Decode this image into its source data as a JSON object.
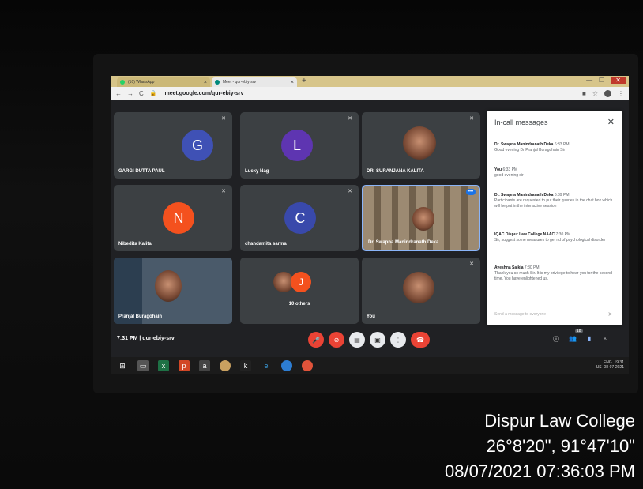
{
  "browser": {
    "tabs": [
      {
        "label": "(10) WhatsApp"
      },
      {
        "label": "Meet - qur-ebiy-srv"
      }
    ],
    "url": "meet.google.com/qur-ebiy-srv"
  },
  "participants": [
    {
      "name": "GARGI DUTTA PAUL",
      "initial": "G",
      "color": "#3f51b5"
    },
    {
      "name": "Lucky Nag",
      "initial": "L",
      "color": "#5e35b1"
    },
    {
      "name": "DR. SURANJANA KALITA"
    },
    {
      "name": "Nibedita Kalita",
      "initial": "N",
      "color": "#f4511e"
    },
    {
      "name": "chandamita sarma",
      "initial": "C",
      "color": "#3949ab"
    },
    {
      "name": "Dr. Swapna Manindranath Deka"
    },
    {
      "name": "Pranjal Buragohain"
    },
    {
      "name": "10 others",
      "initial": "J",
      "color": "#f4511e"
    },
    {
      "name": "You"
    }
  ],
  "chat": {
    "title": "In-call messages",
    "messages": [
      {
        "sender": "Dr. Swapna Manindranath Deka",
        "time": "6:33 PM",
        "text": "Good evening Dr Pranjal Buragohain Sir"
      },
      {
        "sender": "You",
        "time": "6:33 PM",
        "text": "good evening sir"
      },
      {
        "sender": "Dr. Swapna Manindranath Deka",
        "time": "6:39 PM",
        "text": "Participants are requested to put their queries in the chat box which will be put in the interactive session"
      },
      {
        "sender": "IQAC Dispur Law College NAAC",
        "time": "7:30 PM",
        "text": "Sir, suggest some measures to get rid of psychological disorder"
      },
      {
        "sender": "Ayeshna Saikia",
        "time": "7:30 PM",
        "text": "Thank you so much Sir. It is my privilege to hear you for the second time. You have enlightened us."
      }
    ],
    "input_placeholder": "Send a message to everyone"
  },
  "meeting": {
    "info": "7:31 PM  |  qur-ebiy-srv",
    "people_count": "18"
  },
  "taskbar": {
    "lang": "ENG",
    "region": "US",
    "time": "19:31",
    "date": "08-07-2021"
  },
  "watermark": {
    "place": "Dispur Law College",
    "coords": "26°8'20\", 91°47'10\"",
    "datetime": "08/07/2021 07:36:03 PM"
  },
  "colors": {
    "meet_bg": "#202124",
    "tile_bg": "#3c4043",
    "end_call": "#ea4335",
    "active_speaker_border": "#8ab4f8"
  }
}
